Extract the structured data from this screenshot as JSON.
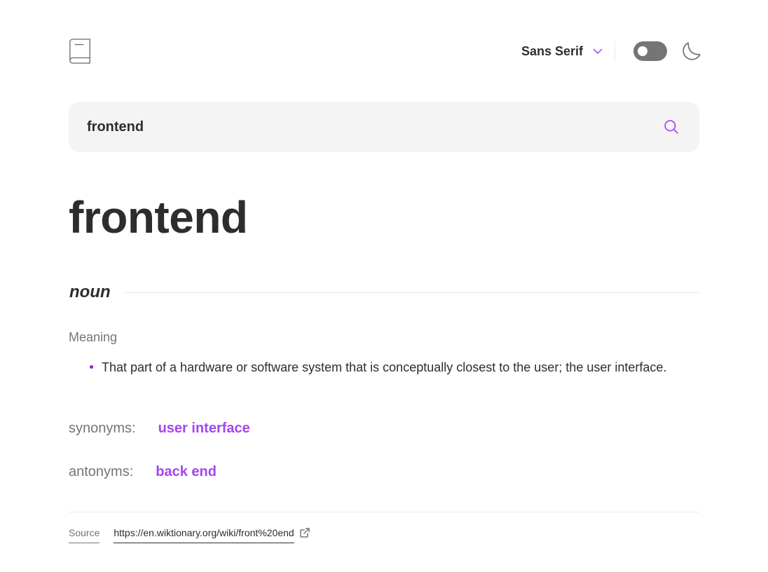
{
  "header": {
    "font_selector": "Sans Serif",
    "theme_toggle": "off",
    "icons": [
      "book-icon",
      "chevron-down-icon",
      "moon-icon"
    ]
  },
  "search": {
    "value": "frontend",
    "icon": "search-icon"
  },
  "entry": {
    "word": "frontend",
    "part_of_speech": "noun",
    "meaning_heading": "Meaning",
    "definitions": [
      "That part of a hardware or software system that is conceptually closest to the user; the user interface."
    ],
    "synonyms_label": "synonyms:",
    "synonyms": "user interface",
    "antonyms_label": "antonyms:",
    "antonyms": "back end"
  },
  "footer": {
    "source_label": "Source",
    "source_url": "https://en.wiktionary.org/wiki/front%20end",
    "icon": "external-link-icon"
  },
  "colors": {
    "accent": "#a445ed",
    "text": "#2d2d2d",
    "muted": "#757575",
    "input_bg": "#f4f4f4",
    "divider": "#e9e9e9"
  }
}
